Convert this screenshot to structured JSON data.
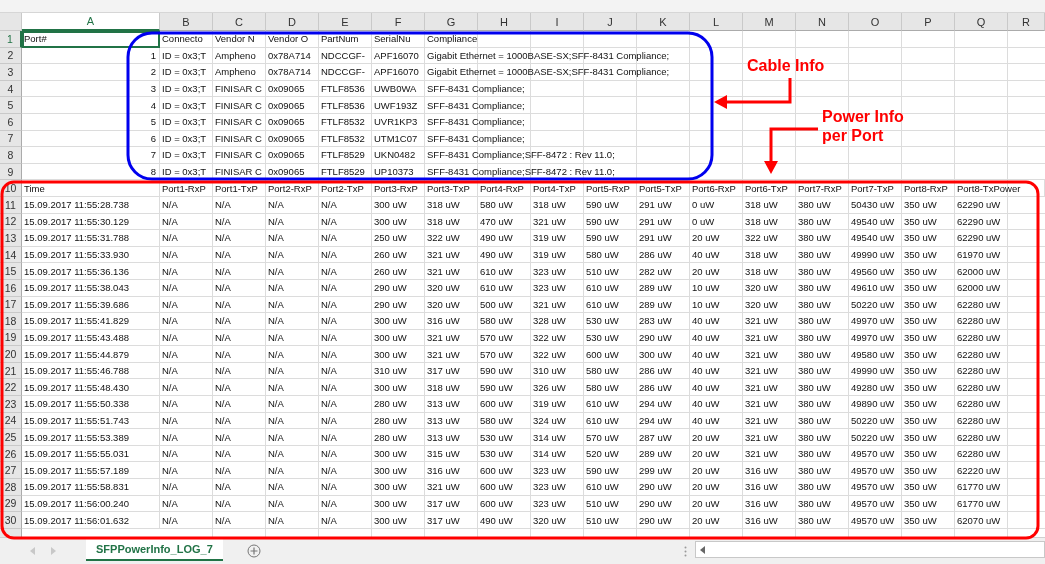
{
  "column_letters": [
    "A",
    "B",
    "C",
    "D",
    "E",
    "F",
    "G",
    "H",
    "I",
    "J",
    "K",
    "L",
    "M",
    "N",
    "O",
    "P",
    "Q",
    "R"
  ],
  "cable_info": {
    "header": {
      "row": "1",
      "port": {
        "text": "Port#",
        "selected": true
      },
      "cells": [
        "Connecto",
        "Vendor N",
        "Vendor O",
        "PartNum",
        "SerialNu",
        "Compliance"
      ]
    },
    "rows": [
      {
        "row": "2",
        "port": "1",
        "cells": [
          "ID = 0x3;T",
          "Ampheno",
          "0x78A714",
          "NDCCGF-",
          "APF16070"
        ],
        "compliance": "Gigabit Ethernet = 1000BASE-SX;SFF-8431 Compliance;"
      },
      {
        "row": "3",
        "port": "2",
        "cells": [
          "ID = 0x3;T",
          "Ampheno",
          "0x78A714",
          "NDCCGF-",
          "APF16070"
        ],
        "compliance": "Gigabit Ethernet = 1000BASE-SX;SFF-8431 Compliance;"
      },
      {
        "row": "4",
        "port": "3",
        "cells": [
          "ID = 0x3;T",
          "FINISAR C",
          "0x09065",
          "FTLF8536",
          "UWB0WA"
        ],
        "compliance": "SFF-8431 Compliance;"
      },
      {
        "row": "5",
        "port": "4",
        "cells": [
          "ID = 0x3;T",
          "FINISAR C",
          "0x09065",
          "FTLF8536",
          "UWF193Z"
        ],
        "compliance": "SFF-8431 Compliance;"
      },
      {
        "row": "6",
        "port": "5",
        "cells": [
          "ID = 0x3;T",
          "FINISAR C",
          "0x09065",
          "FTLF8532",
          "UVR1KP3"
        ],
        "compliance": "SFF-8431 Compliance;"
      },
      {
        "row": "7",
        "port": "6",
        "cells": [
          "ID = 0x3;T",
          "FINISAR C",
          "0x09065",
          "FTLF8532",
          "UTM1C07"
        ],
        "compliance": "SFF-8431 Compliance;"
      },
      {
        "row": "8",
        "port": "7",
        "cells": [
          "ID = 0x3;T",
          "FINISAR C",
          "0x09065",
          "FTLF8529",
          "UKN0482"
        ],
        "compliance": "SFF-8431 Compliance;SFF-8472 : Rev 11.0;"
      },
      {
        "row": "9",
        "port": "8",
        "cells": [
          "ID = 0x3;T",
          "FINISAR C",
          "0x09065",
          "FTLF8529",
          "UP10373"
        ],
        "compliance": "SFF-8431 Compliance;SFF-8472 : Rev 11.0;"
      }
    ]
  },
  "power_info": {
    "header": {
      "row": "10",
      "cells": [
        "Time",
        "Port1-RxP",
        "Port1-TxP",
        "Port2-RxP",
        "Port2-TxP",
        "Port3-RxP",
        "Port3-TxP",
        "Port4-RxP",
        "Port4-TxP",
        "Port5-RxP",
        "Port5-TxP",
        "Port6-RxP",
        "Port6-TxP",
        "Port7-RxP",
        "Port7-TxP",
        "Port8-RxP",
        "Port8-TxPower"
      ]
    },
    "rows": [
      {
        "row": "11",
        "cells": [
          "15.09.2017 11:55:28.738",
          "N/A",
          "N/A",
          "N/A",
          "N/A",
          "300 uW",
          "318 uW",
          "580 uW",
          "318 uW",
          "590 uW",
          "291 uW",
          "0 uW",
          "318 uW",
          "380 uW",
          "50430 uW",
          "350 uW",
          "62290 uW"
        ]
      },
      {
        "row": "12",
        "cells": [
          "15.09.2017 11:55:30.129",
          "N/A",
          "N/A",
          "N/A",
          "N/A",
          "300 uW",
          "318 uW",
          "470 uW",
          "321 uW",
          "590 uW",
          "291 uW",
          "0 uW",
          "318 uW",
          "380 uW",
          "49540 uW",
          "350 uW",
          "62290 uW"
        ]
      },
      {
        "row": "13",
        "cells": [
          "15.09.2017 11:55:31.788",
          "N/A",
          "N/A",
          "N/A",
          "N/A",
          "250 uW",
          "322 uW",
          "490 uW",
          "319 uW",
          "590 uW",
          "291 uW",
          "20 uW",
          "322 uW",
          "380 uW",
          "49540 uW",
          "350 uW",
          "62290 uW"
        ]
      },
      {
        "row": "14",
        "cells": [
          "15.09.2017 11:55:33.930",
          "N/A",
          "N/A",
          "N/A",
          "N/A",
          "260 uW",
          "321 uW",
          "490 uW",
          "319 uW",
          "580 uW",
          "286 uW",
          "40 uW",
          "318 uW",
          "380 uW",
          "49990 uW",
          "350 uW",
          "61970 uW"
        ]
      },
      {
        "row": "15",
        "cells": [
          "15.09.2017 11:55:36.136",
          "N/A",
          "N/A",
          "N/A",
          "N/A",
          "260 uW",
          "321 uW",
          "610 uW",
          "323 uW",
          "510 uW",
          "282 uW",
          "20 uW",
          "318 uW",
          "380 uW",
          "49560 uW",
          "350 uW",
          "62000 uW"
        ]
      },
      {
        "row": "16",
        "cells": [
          "15.09.2017 11:55:38.043",
          "N/A",
          "N/A",
          "N/A",
          "N/A",
          "290 uW",
          "320 uW",
          "610 uW",
          "323 uW",
          "610 uW",
          "289 uW",
          "10 uW",
          "320 uW",
          "380 uW",
          "49610 uW",
          "350 uW",
          "62000 uW"
        ]
      },
      {
        "row": "17",
        "cells": [
          "15.09.2017 11:55:39.686",
          "N/A",
          "N/A",
          "N/A",
          "N/A",
          "290 uW",
          "320 uW",
          "500 uW",
          "321 uW",
          "610 uW",
          "289 uW",
          "10 uW",
          "320 uW",
          "380 uW",
          "50220 uW",
          "350 uW",
          "62280 uW"
        ]
      },
      {
        "row": "18",
        "cells": [
          "15.09.2017 11:55:41.829",
          "N/A",
          "N/A",
          "N/A",
          "N/A",
          "300 uW",
          "316 uW",
          "580 uW",
          "328 uW",
          "530 uW",
          "283 uW",
          "40 uW",
          "321 uW",
          "380 uW",
          "49970 uW",
          "350 uW",
          "62280 uW"
        ]
      },
      {
        "row": "19",
        "cells": [
          "15.09.2017 11:55:43.488",
          "N/A",
          "N/A",
          "N/A",
          "N/A",
          "300 uW",
          "321 uW",
          "570 uW",
          "322 uW",
          "530 uW",
          "290 uW",
          "40 uW",
          "321 uW",
          "380 uW",
          "49970 uW",
          "350 uW",
          "62280 uW"
        ]
      },
      {
        "row": "20",
        "cells": [
          "15.09.2017 11:55:44.879",
          "N/A",
          "N/A",
          "N/A",
          "N/A",
          "300 uW",
          "321 uW",
          "570 uW",
          "322 uW",
          "600 uW",
          "300 uW",
          "40 uW",
          "321 uW",
          "380 uW",
          "49580 uW",
          "350 uW",
          "62280 uW"
        ]
      },
      {
        "row": "21",
        "cells": [
          "15.09.2017 11:55:46.788",
          "N/A",
          "N/A",
          "N/A",
          "N/A",
          "310 uW",
          "317 uW",
          "590 uW",
          "310 uW",
          "580 uW",
          "286 uW",
          "40 uW",
          "321 uW",
          "380 uW",
          "49990 uW",
          "350 uW",
          "62280 uW"
        ]
      },
      {
        "row": "22",
        "cells": [
          "15.09.2017 11:55:48.430",
          "N/A",
          "N/A",
          "N/A",
          "N/A",
          "300 uW",
          "318 uW",
          "590 uW",
          "326 uW",
          "580 uW",
          "286 uW",
          "40 uW",
          "321 uW",
          "380 uW",
          "49280 uW",
          "350 uW",
          "62280 uW"
        ]
      },
      {
        "row": "23",
        "cells": [
          "15.09.2017 11:55:50.338",
          "N/A",
          "N/A",
          "N/A",
          "N/A",
          "280 uW",
          "313 uW",
          "600 uW",
          "319 uW",
          "610 uW",
          "294 uW",
          "40 uW",
          "321 uW",
          "380 uW",
          "49890 uW",
          "350 uW",
          "62280 uW"
        ]
      },
      {
        "row": "24",
        "cells": [
          "15.09.2017 11:55:51.743",
          "N/A",
          "N/A",
          "N/A",
          "N/A",
          "280 uW",
          "313 uW",
          "580 uW",
          "324 uW",
          "610 uW",
          "294 uW",
          "40 uW",
          "321 uW",
          "380 uW",
          "50220 uW",
          "350 uW",
          "62280 uW"
        ]
      },
      {
        "row": "25",
        "cells": [
          "15.09.2017 11:55:53.389",
          "N/A",
          "N/A",
          "N/A",
          "N/A",
          "280 uW",
          "313 uW",
          "530 uW",
          "314 uW",
          "570 uW",
          "287 uW",
          "20 uW",
          "321 uW",
          "380 uW",
          "50220 uW",
          "350 uW",
          "62280 uW"
        ]
      },
      {
        "row": "26",
        "cells": [
          "15.09.2017 11:55:55.031",
          "N/A",
          "N/A",
          "N/A",
          "N/A",
          "300 uW",
          "315 uW",
          "530 uW",
          "314 uW",
          "520 uW",
          "289 uW",
          "20 uW",
          "321 uW",
          "380 uW",
          "49570 uW",
          "350 uW",
          "62280 uW"
        ]
      },
      {
        "row": "27",
        "cells": [
          "15.09.2017 11:55:57.189",
          "N/A",
          "N/A",
          "N/A",
          "N/A",
          "300 uW",
          "316 uW",
          "600 uW",
          "323 uW",
          "590 uW",
          "299 uW",
          "20 uW",
          "316 uW",
          "380 uW",
          "49570 uW",
          "350 uW",
          "62220 uW"
        ]
      },
      {
        "row": "28",
        "cells": [
          "15.09.2017 11:55:58.831",
          "N/A",
          "N/A",
          "N/A",
          "N/A",
          "300 uW",
          "321 uW",
          "600 uW",
          "323 uW",
          "610 uW",
          "290 uW",
          "20 uW",
          "316 uW",
          "380 uW",
          "49570 uW",
          "350 uW",
          "61770 uW"
        ]
      },
      {
        "row": "29",
        "cells": [
          "15.09.2017 11:56:00.240",
          "N/A",
          "N/A",
          "N/A",
          "N/A",
          "300 uW",
          "317 uW",
          "600 uW",
          "323 uW",
          "510 uW",
          "290 uW",
          "20 uW",
          "316 uW",
          "380 uW",
          "49570 uW",
          "350 uW",
          "61770 uW"
        ]
      },
      {
        "row": "30",
        "cells": [
          "15.09.2017 11:56:01.632",
          "N/A",
          "N/A",
          "N/A",
          "N/A",
          "300 uW",
          "317 uW",
          "490 uW",
          "320 uW",
          "510 uW",
          "290 uW",
          "20 uW",
          "316 uW",
          "380 uW",
          "49570 uW",
          "350 uW",
          "62070 uW"
        ]
      }
    ]
  },
  "annotations": [
    "Cable Info",
    "Power Info per Port"
  ],
  "sheet_tabs": [
    {
      "label": "SFPPowerInfo_LOG_7",
      "selected": true
    }
  ]
}
